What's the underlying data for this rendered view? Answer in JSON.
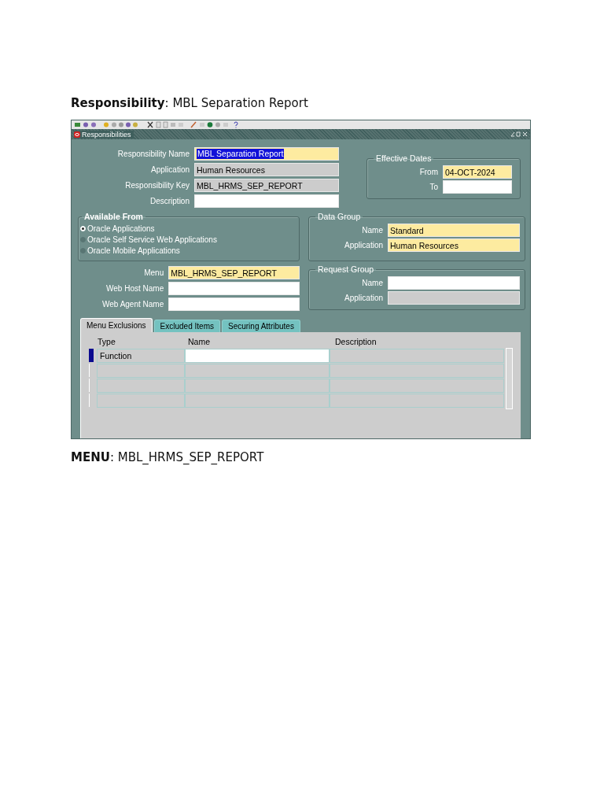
{
  "heading": "**Responsibility**: MBL Separation Report",
  "window": {
    "title": "Responsibilities"
  },
  "fields": [
    {
      "label": "Responsibility Name",
      "value": "MBL Separation Report",
      "kind": "required",
      "highlighted": true
    },
    {
      "label": "Application",
      "value": "Human Resources",
      "kind": "readonly"
    },
    {
      "label": "Responsibility Key",
      "value": "MBL_HRMS_SEP_REPORT",
      "kind": "readonly"
    },
    {
      "label": "Description",
      "kind": "plain"
    }
  ],
  "effective_dates": {
    "title": "Effective Dates",
    "fields": [
      {
        "label": "From",
        "value": "04-OCT-2024",
        "kind": "required"
      },
      {
        "label": "To",
        "kind": "plain"
      }
    ]
  },
  "available_from": {
    "title": "Available From",
    "options": [
      {
        "label": "Oracle Applications",
        "selected": true
      },
      {
        "label": "Oracle Self Service Web Applications",
        "selected": false
      },
      {
        "label": "Oracle Mobile Applications",
        "selected": false
      }
    ]
  },
  "data_group": {
    "title": "Data Group",
    "fields": [
      {
        "label": "Name",
        "value": "Standard",
        "kind": "required"
      },
      {
        "label": "Application",
        "value": "Human Resources",
        "kind": "required"
      }
    ]
  },
  "menu_fields": [
    {
      "label": "Menu",
      "value": "MBL_HRMS_SEP_REPORT",
      "kind": "required"
    },
    {
      "label": "Web Host Name",
      "kind": "plain"
    },
    {
      "label": "Web Agent Name",
      "kind": "plain"
    }
  ],
  "request_group": {
    "title": "Request Group",
    "fields": [
      {
        "label": "Name",
        "kind": "plain"
      },
      {
        "label": "Application",
        "kind": "readonly"
      }
    ]
  },
  "tabs": [
    {
      "label": "Menu Exclusions",
      "selected": true
    },
    {
      "label": "Excluded Items",
      "selected": false
    },
    {
      "label": "Securing Attributes",
      "selected": false
    }
  ],
  "table": {
    "columns": [
      "Type",
      "Name",
      "Description"
    ],
    "rows": [
      {
        "type": "Function",
        "current": true
      },
      {
        "current": false
      },
      {
        "current": false
      },
      {
        "current": false
      }
    ]
  },
  "footer": "**MENU**: MBL_HRMS_SEP_REPORT"
}
